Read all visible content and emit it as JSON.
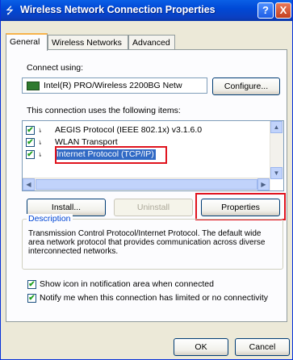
{
  "window": {
    "title": "Wireless Network Connection Properties",
    "help_label": "?",
    "close_label": "X"
  },
  "tabs": [
    {
      "label": "General"
    },
    {
      "label": "Wireless Networks"
    },
    {
      "label": "Advanced"
    }
  ],
  "general": {
    "connect_using_label": "Connect using:",
    "adapter_name": "Intel(R) PRO/Wireless 2200BG Netw",
    "configure_label": "Configure...",
    "items_label": "This connection uses the following items:",
    "items": [
      {
        "label": "AEGIS Protocol (IEEE 802.1x) v3.1.6.0",
        "checked": true
      },
      {
        "label": "WLAN Transport",
        "checked": true
      },
      {
        "label": "Internet Protocol (TCP/IP)",
        "checked": true,
        "selected": true
      }
    ],
    "install_label": "Install...",
    "uninstall_label": "Uninstall",
    "properties_label": "Properties",
    "description_title": "Description",
    "description_text": "Transmission Control Protocol/Internet Protocol. The default wide area network protocol that provides communication across diverse interconnected networks.",
    "show_icon_label": "Show icon in notification area when connected",
    "show_icon_checked": true,
    "notify_label": "Notify me when this connection has limited or no connectivity",
    "notify_checked": true
  },
  "footer": {
    "ok_label": "OK",
    "cancel_label": "Cancel"
  },
  "colors": {
    "titlebar": "#0049d6",
    "highlight": "#e0141e",
    "selection": "#316ac5"
  }
}
